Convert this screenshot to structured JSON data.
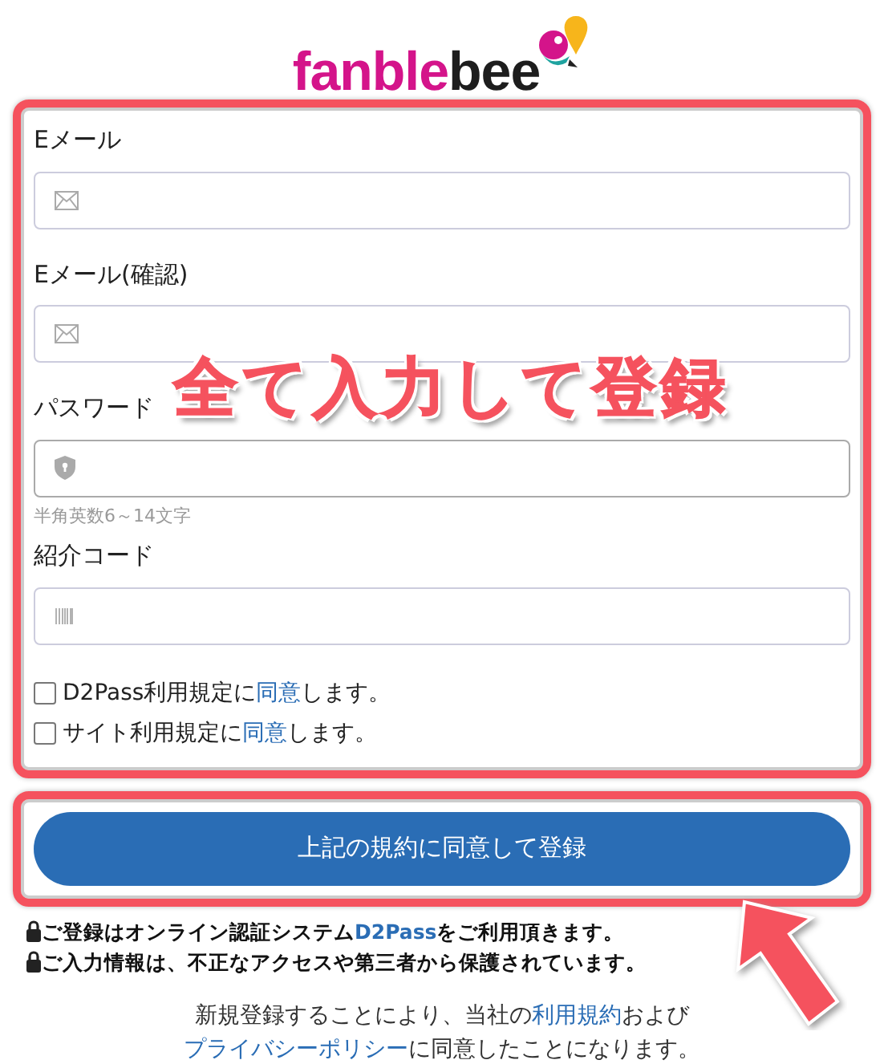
{
  "logo": {
    "part1": "fanble",
    "part2": "bee"
  },
  "fields": [
    {
      "label": "Eメール",
      "kind": "email"
    },
    {
      "label": "Eメール(確認)",
      "kind": "email"
    },
    {
      "label": "パスワード",
      "kind": "password",
      "hint": "半角英数6～14文字"
    },
    {
      "label": "紹介コード",
      "kind": "code"
    }
  ],
  "agreements": [
    {
      "before": "D2Pass利用規定に",
      "link": "同意",
      "after": "します。",
      "checked": false
    },
    {
      "before": "サイト利用規定に",
      "link": "同意",
      "after": "します。",
      "checked": false
    }
  ],
  "submit": "上記の規約に同意して登録",
  "notices": [
    [
      {
        "text": "ご登録はオンライン認証システム",
        "link": false
      },
      {
        "text": "D2Pass",
        "link": true
      },
      {
        "text": "をご利用頂きます。",
        "link": false
      }
    ],
    [
      {
        "text": "ご入力情報は、不正なアクセスや第三者から保護されています。",
        "link": false
      }
    ]
  ],
  "footer": [
    [
      {
        "text": "新規登録することにより、当社の",
        "link": false
      },
      {
        "text": "利用規約",
        "link": true
      },
      {
        "text": "および",
        "link": false
      }
    ],
    [
      {
        "text": "プライバシーポリシー",
        "link": true
      },
      {
        "text": "に同意したことになります。",
        "link": false
      }
    ]
  ],
  "annotation": {
    "text": "全て入力して登録"
  }
}
